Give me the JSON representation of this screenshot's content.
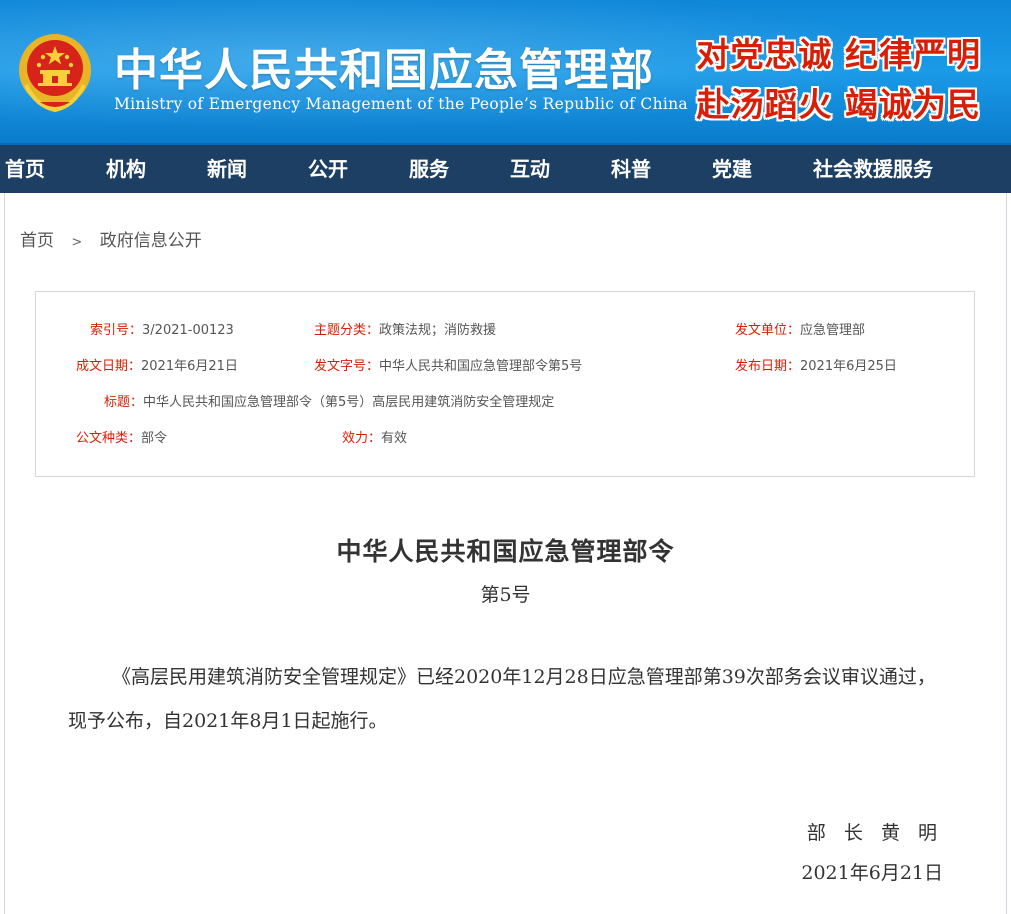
{
  "header": {
    "title": "中华人民共和国应急管理部",
    "subtitle": "Ministry of Emergency Management of the People’s Republic of China",
    "slogan_line1": "对党忠诚 纪律严明",
    "slogan_line2": "赴汤蹈火 竭诚为民",
    "emblem_icon": "national-emblem-icon",
    "colors": {
      "header_blue": "#1a9ae8",
      "nav_bg": "#1d3f63",
      "label_red": "#d81e06"
    }
  },
  "nav": {
    "items": [
      {
        "label": "首页"
      },
      {
        "label": "机构"
      },
      {
        "label": "新闻"
      },
      {
        "label": "公开"
      },
      {
        "label": "服务"
      },
      {
        "label": "互动"
      },
      {
        "label": "科普"
      },
      {
        "label": "党建"
      },
      {
        "label": "社会救援服务"
      }
    ]
  },
  "breadcrumb": {
    "home": "首页",
    "separator": ">",
    "current": "政府信息公开"
  },
  "meta": {
    "index_no": {
      "label": "索引号：",
      "value": "3/2021-00123"
    },
    "topic": {
      "label": "主题分类：",
      "value": "政策法规；消防救援"
    },
    "issuer": {
      "label": "发文单位：",
      "value": "应急管理部"
    },
    "created": {
      "label": "成文日期：",
      "value": "2021年6月21日"
    },
    "doc_no": {
      "label": "发文字号：",
      "value": "中华人民共和国应急管理部令第5号"
    },
    "published": {
      "label": "发布日期：",
      "value": "2021年6月25日"
    },
    "title": {
      "label": "标题：",
      "value": "中华人民共和国应急管理部令（第5号）高层民用建筑消防安全管理规定"
    },
    "doc_type": {
      "label": "公文种类：",
      "value": "部令"
    },
    "validity": {
      "label": "效力：",
      "value": "有效"
    }
  },
  "document": {
    "title": "中华人民共和国应急管理部令",
    "number": "第5号",
    "paragraph": "《高层民用建筑消防安全管理规定》已经2020年12月28日应急管理部第39次部务会议审议通过，现予公布，自2021年8月1日起施行。",
    "signer": "部 长 黄 明",
    "date": "2021年6月21日"
  }
}
